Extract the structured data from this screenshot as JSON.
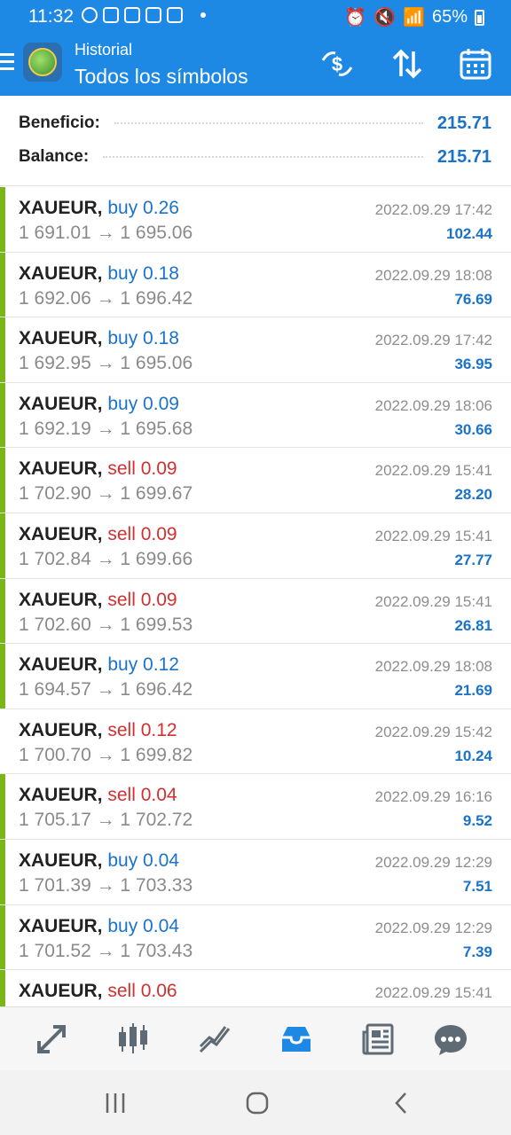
{
  "status_bar": {
    "time": "11:32",
    "battery": "65%"
  },
  "header": {
    "subtitle": "Historial",
    "title": "Todos los símbolos",
    "icons": [
      "menu-icon",
      "metatrader-logo",
      "currency-exchange-icon",
      "sort-icon",
      "calendar-icon"
    ]
  },
  "summary": {
    "profit_label": "Beneficio:",
    "profit_value": "215.71",
    "balance_label": "Balance:",
    "balance_value": "215.71"
  },
  "deals": [
    {
      "symbol": "XAUEUR,",
      "action": "buy 0.26",
      "side": "buy",
      "prices": "1 691.01 → 1 695.06",
      "time": "2022.09.29 17:42",
      "profit": "102.44",
      "bar": true
    },
    {
      "symbol": "XAUEUR,",
      "action": "buy 0.18",
      "side": "buy",
      "prices": "1 692.06 → 1 696.42",
      "time": "2022.09.29 18:08",
      "profit": "76.69",
      "bar": true
    },
    {
      "symbol": "XAUEUR,",
      "action": "buy 0.18",
      "side": "buy",
      "prices": "1 692.95 → 1 695.06",
      "time": "2022.09.29 17:42",
      "profit": "36.95",
      "bar": true
    },
    {
      "symbol": "XAUEUR,",
      "action": "buy 0.09",
      "side": "buy",
      "prices": "1 692.19 → 1 695.68",
      "time": "2022.09.29 18:06",
      "profit": "30.66",
      "bar": true
    },
    {
      "symbol": "XAUEUR,",
      "action": "sell 0.09",
      "side": "sell",
      "prices": "1 702.90 → 1 699.67",
      "time": "2022.09.29 15:41",
      "profit": "28.20",
      "bar": true
    },
    {
      "symbol": "XAUEUR,",
      "action": "sell 0.09",
      "side": "sell",
      "prices": "1 702.84 → 1 699.66",
      "time": "2022.09.29 15:41",
      "profit": "27.77",
      "bar": true
    },
    {
      "symbol": "XAUEUR,",
      "action": "sell 0.09",
      "side": "sell",
      "prices": "1 702.60 → 1 699.53",
      "time": "2022.09.29 15:41",
      "profit": "26.81",
      "bar": true
    },
    {
      "symbol": "XAUEUR,",
      "action": "buy 0.12",
      "side": "buy",
      "prices": "1 694.57 → 1 696.42",
      "time": "2022.09.29 18:08",
      "profit": "21.69",
      "bar": true
    },
    {
      "symbol": "XAUEUR,",
      "action": "sell 0.12",
      "side": "sell",
      "prices": "1 700.70 → 1 699.82",
      "time": "2022.09.29 15:42",
      "profit": "10.24",
      "bar": false
    },
    {
      "symbol": "XAUEUR,",
      "action": "sell 0.04",
      "side": "sell",
      "prices": "1 705.17 → 1 702.72",
      "time": "2022.09.29 16:16",
      "profit": "9.52",
      "bar": true
    },
    {
      "symbol": "XAUEUR,",
      "action": "buy 0.04",
      "side": "buy",
      "prices": "1 701.39 → 1 703.33",
      "time": "2022.09.29 12:29",
      "profit": "7.51",
      "bar": true
    },
    {
      "symbol": "XAUEUR,",
      "action": "buy 0.04",
      "side": "buy",
      "prices": "1 701.52 → 1 703.43",
      "time": "2022.09.29 12:29",
      "profit": "7.39",
      "bar": true
    },
    {
      "symbol": "XAUEUR,",
      "action": "sell 0.06",
      "side": "sell",
      "prices": "",
      "time": "2022.09.29 15:41",
      "profit": "",
      "bar": true
    }
  ],
  "bottom_nav": [
    "quotes-icon",
    "chart-icon",
    "trade-icon",
    "history-icon",
    "news-icon",
    "chat-icon"
  ],
  "colors": {
    "header": "#1e88e5",
    "buy": "#1a73c8",
    "sell": "#d32f2f",
    "profit": "#1a73c8",
    "bar": "#7cb518",
    "active_nav": "#1e88e5"
  }
}
